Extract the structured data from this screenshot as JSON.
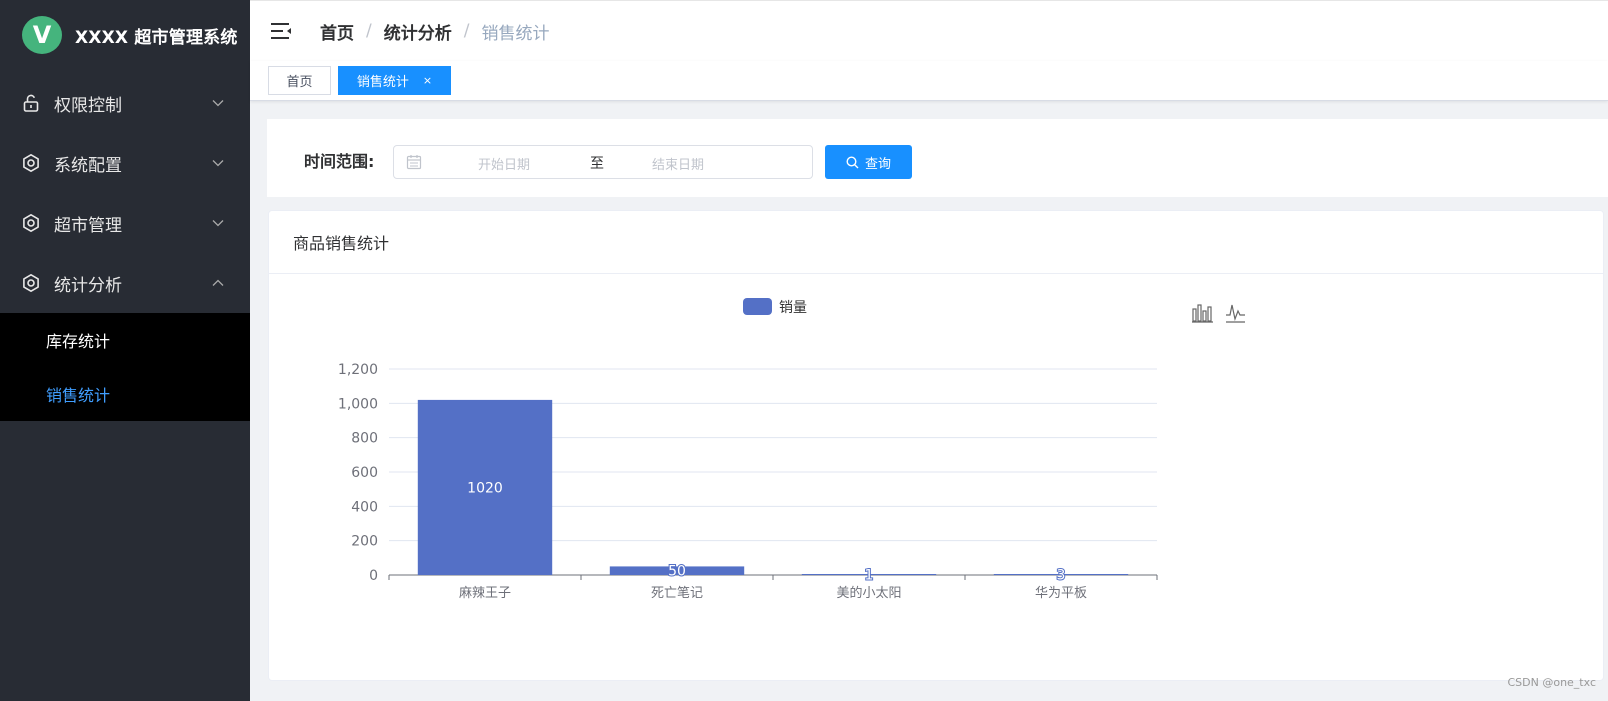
{
  "app": {
    "title": "XXXX 超市管理系统",
    "logo_letter": "V"
  },
  "sidebar": {
    "items": [
      {
        "label": "权限控制",
        "icon": "unlock-icon",
        "expanded": false
      },
      {
        "label": "系统配置",
        "icon": "gear-icon",
        "expanded": false
      },
      {
        "label": "超市管理",
        "icon": "gear-icon",
        "expanded": false
      },
      {
        "label": "统计分析",
        "icon": "gear-icon",
        "expanded": true
      }
    ],
    "subitems": [
      {
        "label": "库存统计",
        "active": false
      },
      {
        "label": "销售统计",
        "active": true
      }
    ]
  },
  "header": {
    "breadcrumb": [
      "首页",
      "统计分析",
      "销售统计"
    ]
  },
  "tabs": [
    {
      "label": "首页",
      "active": false
    },
    {
      "label": "销售统计",
      "active": true,
      "close": "×"
    }
  ],
  "filter": {
    "label": "时间范围:",
    "start_placeholder": "开始日期",
    "range_separator": "至",
    "end_placeholder": "结束日期",
    "query_label": "查询"
  },
  "chart_card": {
    "title": "商品销售统计"
  },
  "chart_data": {
    "type": "bar",
    "categories": [
      "麻辣王子",
      "死亡笔记",
      "美的小太阳",
      "华为平板"
    ],
    "series": [
      {
        "name": "销量",
        "values": [
          1020,
          50,
          1,
          3
        ]
      }
    ],
    "ylim": [
      0,
      1200
    ],
    "yticks": [
      0,
      200,
      400,
      600,
      800,
      1000,
      1200
    ],
    "ytick_labels": [
      "0",
      "200",
      "400",
      "600",
      "800",
      "1,000",
      "1,200"
    ],
    "data_labels": [
      "1020",
      "50",
      "1",
      "3"
    ],
    "grid": true,
    "legend": "top-center",
    "color": "#5470c6"
  },
  "colors": {
    "sidebar_bg": "#282c34",
    "submenu_bg": "#000000",
    "accent": "#1890ff",
    "active_submenu": "#409eff",
    "bar": "#5470c6"
  },
  "watermark": "CSDN @one_txc"
}
